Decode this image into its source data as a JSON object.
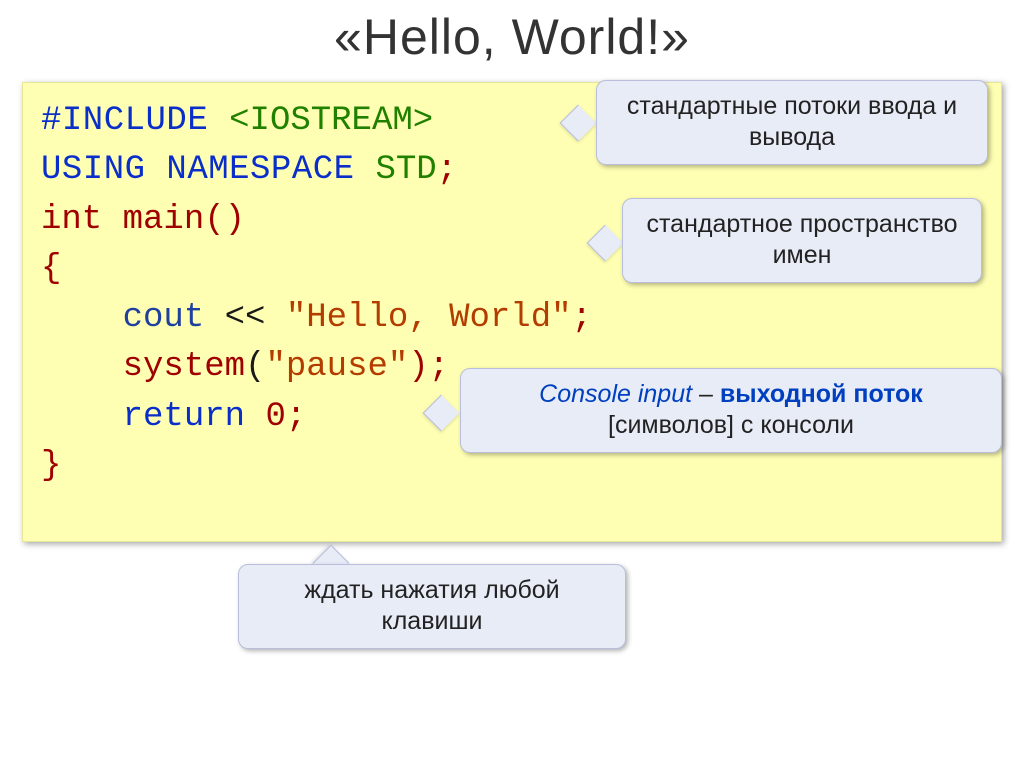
{
  "title": "«Hello, World!»",
  "code": {
    "l1a": "#include ",
    "l1b": "<IOSTREAM>",
    "l2a": "using namespace ",
    "l2b": "STD",
    "l2c": ";",
    "l3": "int main()",
    "l4": "{",
    "l5a": "    ",
    "l5b": "cout",
    "l5c": " << ",
    "l5d": "\"Hello, World\"",
    "l5e": ";",
    "l6a": "    system",
    "l6b": "(",
    "l6c": "\"pause\"",
    "l6d": ");",
    "l7a": "    ",
    "l7b": "return",
    "l7c": " 0;",
    "l8": "}"
  },
  "callouts": {
    "c1": "стандартные потоки ввода и вывода",
    "c2": "стандартное пространство имен",
    "c3a": "Console input",
    "c3b": " – ",
    "c3c": "выходной поток",
    "c3d": "[символов] с консоли",
    "c4": "ждать нажатия любой клавиши"
  }
}
